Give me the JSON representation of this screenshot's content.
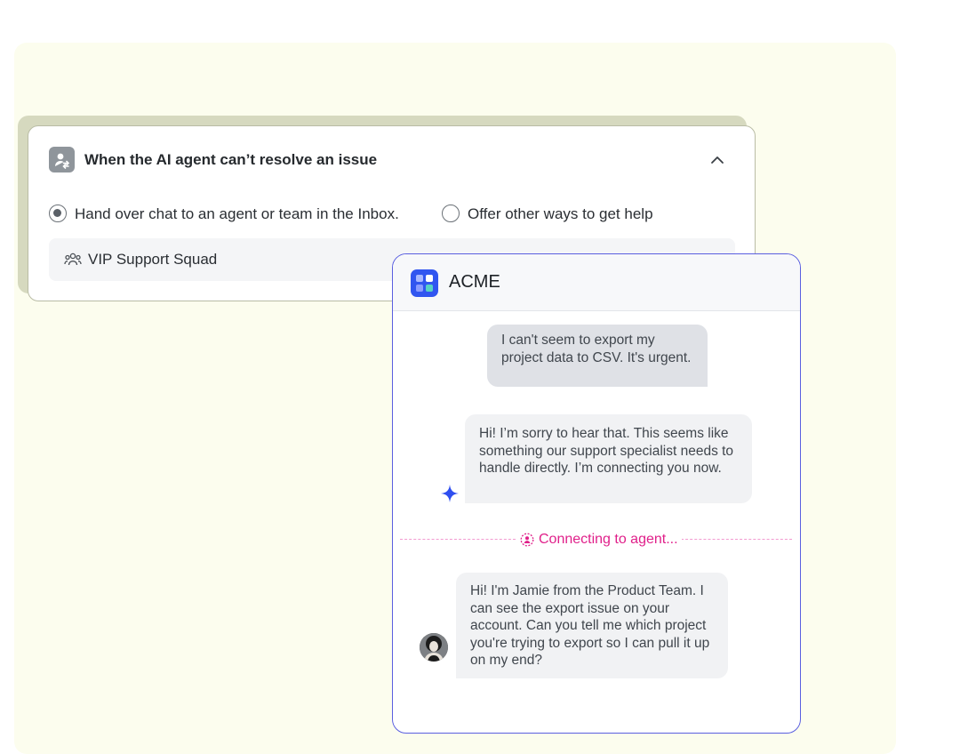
{
  "rule_card": {
    "title": "When the AI agent can’t resolve an issue",
    "options": [
      {
        "label": "Hand over chat to an agent or team in the Inbox.",
        "selected": true
      },
      {
        "label": "Offer other ways to get help",
        "selected": false
      }
    ],
    "team": "VIP Support Squad"
  },
  "chat": {
    "brand": "ACME",
    "messages": {
      "user": "I can't seem to export my project data to CSV. It's urgent.",
      "ai": "Hi! I’m sorry to hear that. This seems like something our support specialist needs to handle directly. I’m connecting you now.",
      "status": "Connecting to agent...",
      "agent": "Hi! I'm Jamie from the Product Team. I can see the export issue on your account. Can you tell me which project you're trying to export so I can pull it up on my end?"
    }
  },
  "colors": {
    "accent": "#3156f0",
    "chat_border": "#5a5fe0",
    "status": "#e0208a",
    "background": "#fcfdee"
  },
  "icons": {
    "header": "user-handover-icon",
    "collapse": "chevron-up-icon",
    "team": "team-icon",
    "ai": "sparkle-icon",
    "status": "agent-connecting-icon"
  }
}
